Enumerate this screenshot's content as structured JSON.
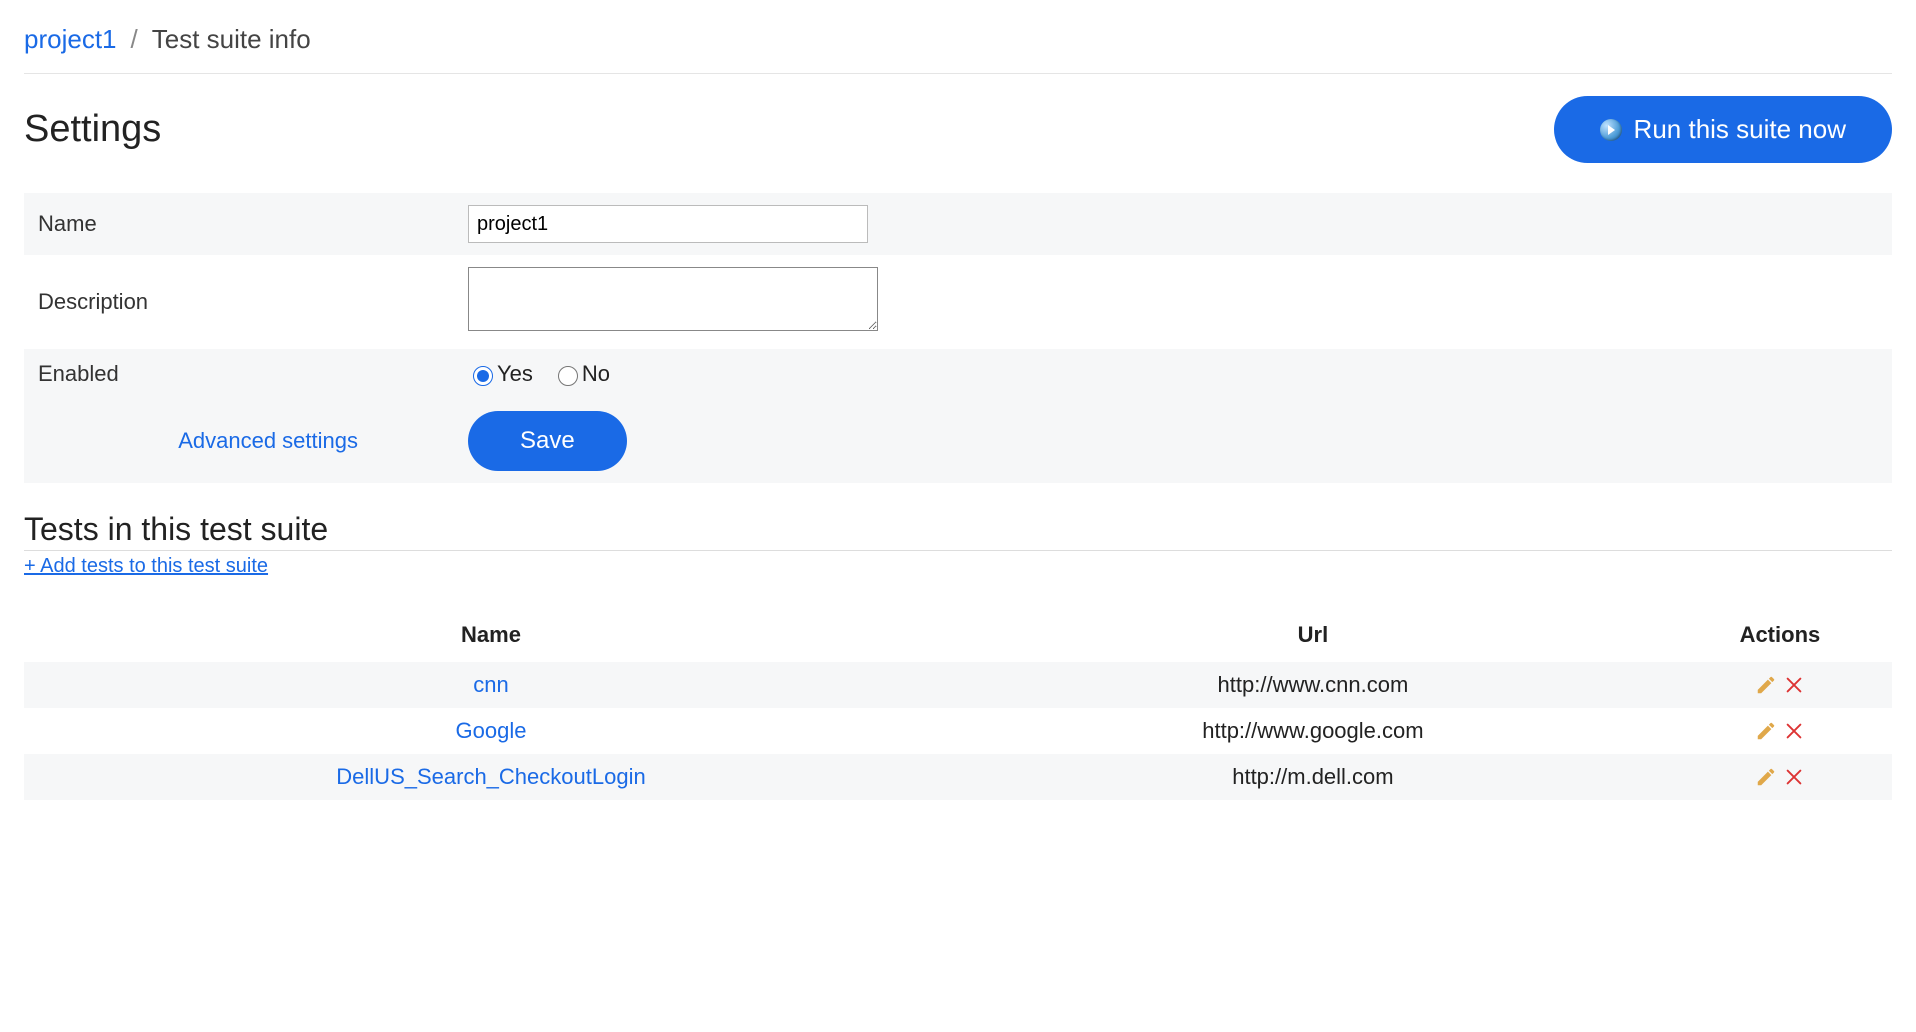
{
  "breadcrumb": {
    "parent": "project1",
    "current": "Test suite info",
    "separator": "/"
  },
  "header": {
    "title": "Settings",
    "run_button": "Run this suite now"
  },
  "form": {
    "name_label": "Name",
    "name_value": "project1",
    "description_label": "Description",
    "description_value": "",
    "enabled_label": "Enabled",
    "enabled_yes": "Yes",
    "enabled_no": "No",
    "enabled_value": "yes",
    "advanced_link": "Advanced settings",
    "save_button": "Save"
  },
  "tests_section": {
    "heading": "Tests in this test suite",
    "add_link": "+ Add tests to this test suite",
    "columns": {
      "name": "Name",
      "url": "Url",
      "actions": "Actions"
    },
    "rows": [
      {
        "name": "cnn",
        "url": "http://www.cnn.com"
      },
      {
        "name": "Google",
        "url": "http://www.google.com"
      },
      {
        "name": "DellUS_Search_CheckoutLogin",
        "url": "http://m.dell.com"
      }
    ]
  }
}
